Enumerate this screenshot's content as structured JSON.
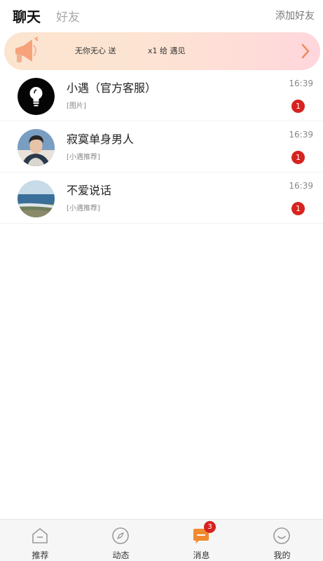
{
  "header": {
    "tab_chat": "聊天",
    "tab_friends": "好友",
    "add_friend": "添加好友"
  },
  "banner": {
    "icon": "megaphone-icon",
    "text_left": "无你无心 送",
    "text_right": "x1 给 遇见",
    "arrow_icon": "chevron-right-icon"
  },
  "chats": [
    {
      "name": "小遇（官方客服）",
      "preview": "[图片]",
      "time": "16:39",
      "unread": "1",
      "avatar": "lightbulb-avatar"
    },
    {
      "name": "寂寞单身男人",
      "preview": "[小遇推荐]",
      "time": "16:39",
      "unread": "1",
      "avatar": "man-photo-avatar"
    },
    {
      "name": "不爱说话",
      "preview": "[小遇推荐]",
      "time": "16:39",
      "unread": "1",
      "avatar": "seascape-photo-avatar"
    }
  ],
  "bottom_nav": [
    {
      "label": "推荐",
      "icon": "home-icon"
    },
    {
      "label": "动态",
      "icon": "compass-icon"
    },
    {
      "label": "消息",
      "icon": "message-icon",
      "badge": "3"
    },
    {
      "label": "我的",
      "icon": "smiley-icon"
    }
  ],
  "colors": {
    "badge_red": "#d6231f",
    "accent_orange": "#f08a2e"
  }
}
